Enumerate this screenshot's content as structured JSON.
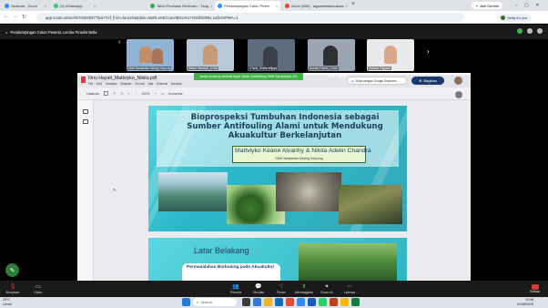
{
  "browser": {
    "tabs": [
      {
        "label": "Seranda - Zoom",
        "color": "#2d8cff"
      },
      {
        "label": "(9) WhatsApp",
        "color": "#25d366"
      },
      {
        "label": "Tabel Penilaian Reviewer - Tang",
        "color": "#34a853"
      },
      {
        "label": "Pendampingan Calon Peser",
        "color": "#2d8cff",
        "active": true
      },
      {
        "label": "Inbox (669) - lagaamelabecausa",
        "color": "#ea4335"
      }
    ],
    "new_tab": "+",
    "url": "app.zoom.us/wc/92734830277/join?ref_from=launch&tpbiw=MoRLeKECcarvIBGUVU7cNctfsl3MIx.1&fromPWA=1",
    "gemini_button": "Ask Gemini",
    "profile_label": "Verify it's you"
  },
  "zoom": {
    "meeting_title": "Pendampingan Calon Peserta Lomba Pinwiht Bella",
    "participants": [
      {
        "name": "SMA Tarakanita Gading Serpong",
        "bg": "#8fb4d6"
      },
      {
        "name": "Wisnu Wirawan_UTarb",
        "bg": "#b7c9d9"
      },
      {
        "name": "UTarbi_Shella Wijaya",
        "bg": "#5d6d7e"
      },
      {
        "name": "Nuraini Faizah_UTarb",
        "bg": "#9aa7b3"
      },
      {
        "name": "Simona Pujiyanti",
        "bg": "#e8eaec"
      }
    ],
    "share_banner": "Anda sedang melihat layar  Siwe Gambiring SMA Tarakanita GS",
    "view_options": "Lihat Opsi",
    "toolbar": [
      {
        "icon": "mic-off-icon",
        "label": "Bunyikan"
      },
      {
        "icon": "video-icon",
        "label": "Video"
      },
      {
        "icon": "participants-icon",
        "label": "Peserta"
      },
      {
        "icon": "chat-icon",
        "label": "Obrolan"
      },
      {
        "icon": "react-icon",
        "label": "React"
      },
      {
        "icon": "share-icon",
        "label": "Membagikan"
      },
      {
        "icon": "ai-icon",
        "label": "Zoom AI"
      },
      {
        "icon": "more-icon",
        "label": "Lainnya"
      }
    ],
    "leave_label": "Keluar"
  },
  "pdf": {
    "filename": "Ilmu Hayati_Mattviyko_Nikita.pdf",
    "menu": [
      "File",
      "Edit",
      "Tampilan",
      "Sisipkan",
      "Format",
      "Alat",
      "Ekstensi",
      "Bantuan"
    ],
    "page_label": "Halaman",
    "zoom_level": "120%",
    "comment_label": "Komentar",
    "open_with": "Buka dengan Google Dokumen",
    "share_button": "Bagikan"
  },
  "slide1": {
    "title": "Bioprospeksi Tumbuhan Indonesia sebagai Sumber Antifouling Alami untuk Mendukung Akuakultur Berkelanjutan",
    "authors": "Mattviyko Keane Alvanhy & Nikita Adelin Chandra",
    "school": "SMA Tarakanita Gading Serpong"
  },
  "slide2": {
    "title": "Latar Belakang",
    "subtitle": "Permasalahan Biofouling pada Akuakultur"
  },
  "taskbar": {
    "weather": "29°C",
    "weather_desc": "Cerah",
    "search_placeholder": "Search",
    "time": "10:58",
    "date": "01/08/2025"
  }
}
